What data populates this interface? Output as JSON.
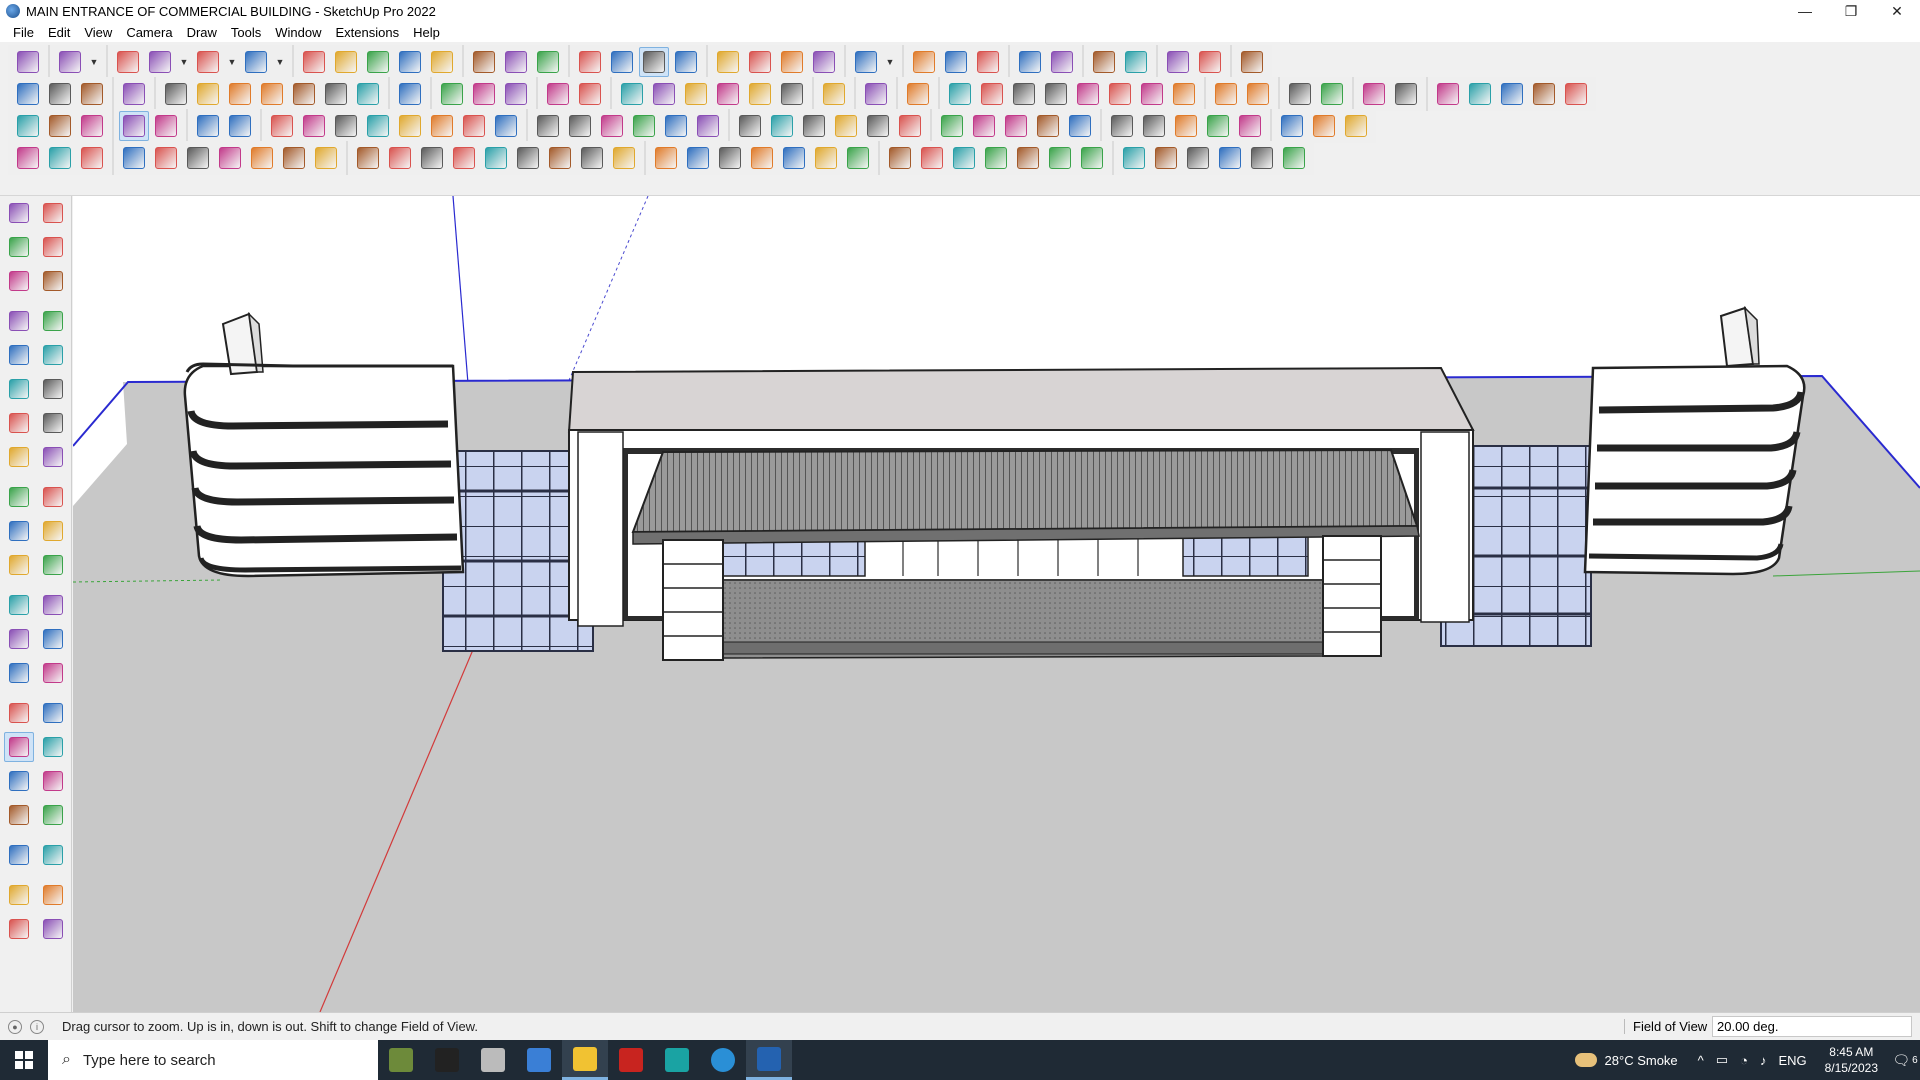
{
  "window": {
    "title": "MAIN ENTRANCE OF COMMERCIAL BUILDING - SketchUp Pro 2022",
    "minimize_glyph": "—",
    "maximize_glyph": "❐",
    "close_glyph": "✕"
  },
  "menu": [
    "File",
    "Edit",
    "View",
    "Camera",
    "Draw",
    "Tools",
    "Window",
    "Extensions",
    "Help"
  ],
  "toolbar_rows": [
    {
      "groups": [
        [
          "zoom-tool-icon"
        ],
        [
          "select-arrow-icon",
          "select-dropdown-icon"
        ],
        [
          "eraser-icon",
          "pencil-line-icon",
          "pencil-dropdown-icon",
          "arc-icon",
          "arc-dropdown-icon",
          "rectangle-icon",
          "rectangle-dropdown-icon"
        ],
        [
          "push-pull-icon",
          "follow-me-icon",
          "move-icon",
          "rotate-icon",
          "scale-icon"
        ],
        [
          "tape-measure-icon",
          "text-tag-icon",
          "paint-bucket-icon"
        ],
        [
          "orbit-icon",
          "pan-icon",
          "zoom-active-icon",
          "zoom-extents-icon"
        ],
        [
          "styles-icon",
          "layers-icon",
          "shadows-icon",
          "fog-icon"
        ],
        [
          "warehouse-icon",
          "warehouse-dropdown-icon"
        ],
        [
          "extension-warehouse-icon",
          "send-to-layout-icon",
          "generate-report-icon"
        ],
        [
          "sandbox-up-icon",
          "sandbox-down-icon"
        ],
        [
          "solid-tools-icon",
          "section-plane-icon"
        ],
        [
          "undo-icon",
          "redo-icon"
        ],
        [
          "hand-icon"
        ]
      ]
    },
    {
      "groups": [
        [
          "box-solid-icon",
          "box-xray-icon",
          "box-textured-icon"
        ],
        [
          "push-pull-red-icon"
        ],
        [
          "cube-down-icon",
          "cube-blue-icon",
          "cube-red-icon",
          "cube-green-icon",
          "cube-north-icon",
          "cube-orange-icon",
          "cube-pink-icon"
        ],
        [
          "curve-icon"
        ],
        [
          "plane-blue-icon",
          "plane-purple-icon",
          "plane-violet-icon"
        ],
        [
          "green-shape-icon",
          "green-star-icon"
        ],
        [
          "house-iso-icon",
          "house-front-icon",
          "house-top-icon",
          "house-right-icon",
          "house-back-icon",
          "house-left-icon"
        ],
        [
          "formula-icon"
        ],
        [
          "leaf-icon"
        ],
        [
          "knife-icon"
        ],
        [
          "rect-shape-icon",
          "circle-shape-icon",
          "hexagon-shape-icon",
          "ellipse-shape-icon",
          "parallelogram-shape-icon",
          "arch-shape-icon",
          "spiral-shape-icon",
          "bezier-icon"
        ],
        [
          "polygon-blue-icon",
          "circle-blue-icon"
        ],
        [
          "measure-red-icon",
          "eraser-pink-icon"
        ],
        [
          "book-icon",
          "grid-icon"
        ],
        [
          "terrain-1-icon",
          "terrain-2-icon",
          "hand-gray-icon",
          "terrain-3-icon",
          "terrain-4-icon"
        ]
      ]
    },
    {
      "groups": [
        [
          "plane-blue-2-icon",
          "plane-blue-3-icon",
          "plane-yellow-icon"
        ],
        [
          "active-text-icon",
          "close-panel-icon"
        ],
        [
          "red-shape-icon",
          "flat-icon"
        ],
        [
          "rotate-orange-icon",
          "red-square-icon",
          "list-icon",
          "flag-icon",
          "box-brown-icon",
          "chain-icon",
          "arc-path-icon",
          "curve-path-icon"
        ],
        [
          "red-cross-icon",
          "green-cross-icon",
          "blue-x-icon",
          "cone-icon",
          "drip-icon",
          "warning-icon"
        ],
        [
          "rope-icon",
          "knot-icon",
          "loop-icon",
          "move-4-icon",
          "bucket-icon",
          "undo-red-icon"
        ],
        [
          "green-box-icon",
          "gear-box-icon",
          "gear-red-icon",
          "crate-icon",
          "red-gem-icon"
        ],
        [
          "gear-brown-icon",
          "window-icon",
          "grid-orange-icon",
          "window-orange-icon",
          "grid-gold-icon"
        ],
        [
          "cross-dots-icon",
          "dotted-circle-icon",
          "components-icon"
        ]
      ]
    },
    {
      "groups": [
        [
          "path-1-icon",
          "path-2-icon",
          "red-car-icon"
        ],
        [
          "red-gear-badge-icon",
          "lamp-icon",
          "outline-1-icon",
          "spring-icon",
          "box-wire-icon",
          "sphere-wire-icon",
          "bracket-icon"
        ],
        [
          "corner-1-icon",
          "corner-2-icon",
          "line-red-icon",
          "ramp-icon",
          "crate-outline-icon",
          "roof-icon",
          "fence-icon",
          "column-icon",
          "hand-palm-icon"
        ],
        [
          "leaf-outline-icon",
          "arrow-left-icon",
          "stairs-icon",
          "ramp-2-icon",
          "stairs-2-icon",
          "stairs-3-icon",
          "stairs-4-icon"
        ],
        [
          "dome-icon",
          "hatch-icon",
          "step-icon",
          "step-2-icon",
          "frame-icon",
          "grid-dark-icon",
          "layers-dark-icon"
        ],
        [
          "bars-icon",
          "wheel-icon",
          "wheel-2-icon",
          "slope-icon",
          "tree-icon",
          "house-outline-icon"
        ]
      ]
    }
  ],
  "left_toolbar": [
    [
      "select-arrow-icon",
      "orbit-3d-icon"
    ],
    [
      "paint-bucket-icon",
      "eraser-icon"
    ],
    [
      "component-icon",
      "tape-measure-icon"
    ],
    [
      "pencil-line-icon",
      "freehand-icon"
    ],
    [
      "rectangle-icon",
      "rotated-rect-icon"
    ],
    [
      "circle-icon",
      "polygon-icon"
    ],
    [
      "arc-icon",
      "two-point-arc-icon"
    ],
    [
      "three-point-arc-icon",
      "pie-icon"
    ],
    [
      "move-icon",
      "push-pull-icon"
    ],
    [
      "rotate-icon",
      "follow-me-icon"
    ],
    [
      "scale-icon",
      "offset-icon"
    ],
    [
      "tape-measure-2-icon",
      "dimension-icon"
    ],
    [
      "protractor-icon",
      "text-icon"
    ],
    [
      "axes-icon",
      "3d-text-icon"
    ],
    [
      "orbit-icon",
      "pan-icon"
    ],
    [
      "zoom-icon",
      "zoom-window-icon"
    ],
    [
      "zoom-extents-icon",
      "previous-view-icon"
    ],
    [
      "position-camera-icon",
      "look-around-icon"
    ],
    [
      "walk-icon",
      "section-plane-icon"
    ],
    [
      "styles-icon",
      "shadows-icon"
    ],
    [
      "layers-icon",
      "fog-icon"
    ]
  ],
  "status": {
    "message": "Drag cursor to zoom.  Up is in, down is out. Shift to change Field of View.",
    "vcb_label": "Field of View",
    "vcb_value": "20.00 deg.",
    "icon_1": "●",
    "icon_2": "i"
  },
  "taskbar": {
    "search_placeholder": "Type here to search",
    "search_glyph": "⌕",
    "apps": [
      "minecraft-icon",
      "headphones-icon",
      "task-view-icon",
      "calculator-icon",
      "file-explorer-icon",
      "autocad-icon",
      "3ds-max-icon",
      "edge-icon",
      "sketchup-icon"
    ],
    "weather": "28°C  Smoke",
    "tray_icons": [
      "^",
      "▭",
      "◔",
      "♪"
    ],
    "language": "ENG",
    "time": "8:45 AM",
    "date": "8/15/2023",
    "notification_count": "6",
    "notification_glyph": "🗨"
  },
  "colors": {
    "ground": "#c8c8c8",
    "glass": "#c9d3ef",
    "canopy": "#8a8a8a",
    "wall": "#ffffff",
    "roof": "#d8d4d4",
    "axis_blue": "#2a2ad0",
    "axis_red": "#d23a3a",
    "axis_green": "#3aa43a"
  }
}
